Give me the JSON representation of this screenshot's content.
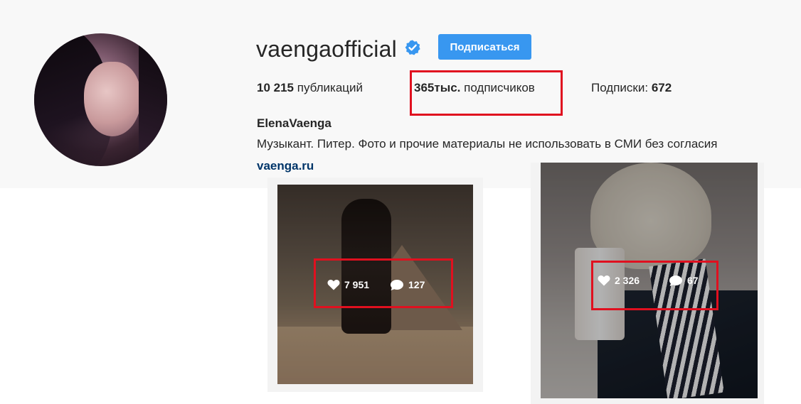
{
  "profile": {
    "username": "vaengaofficial",
    "verified": true,
    "follow_button_label": "Подписаться",
    "stats": {
      "posts_value": "10 215",
      "posts_label": "публикаций",
      "followers_value": "365тыс.",
      "followers_label": "подписчиков",
      "following_label": "Подписки:",
      "following_value": "672"
    },
    "full_name": "ElenaVaenga",
    "bio": "Музыкант. Питер. Фото и прочие материалы не использовать в СМИ без согласия",
    "website": "vaenga.ru"
  },
  "posts": [
    {
      "likes": "7 951",
      "comments": "127"
    },
    {
      "likes": "2 326",
      "comments": "67"
    }
  ],
  "colors": {
    "follow_button": "#3897f0",
    "verified_badge": "#3897f0",
    "highlight_box": "#e0101f",
    "website_link": "#003569"
  },
  "icons": {
    "verified": "verified-badge-icon",
    "likes": "heart-icon",
    "comments": "comment-bubble-icon"
  }
}
